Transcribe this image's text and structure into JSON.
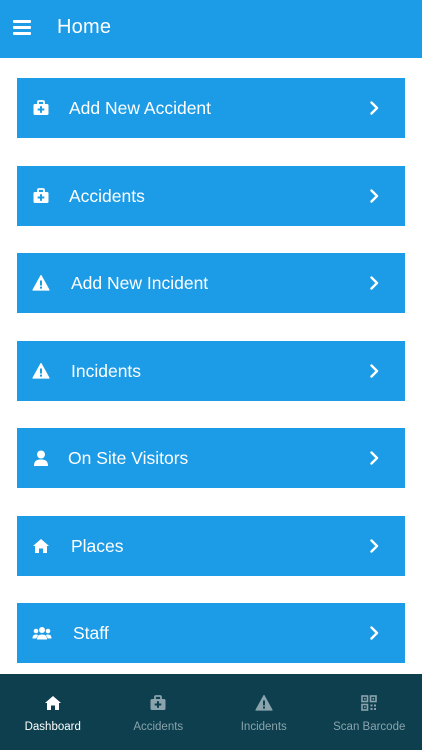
{
  "header": {
    "title": "Home",
    "menu_icon": "hamburger-icon"
  },
  "menu": {
    "items": [
      {
        "label": "Add New Accident",
        "icon": "first-aid-kit-icon"
      },
      {
        "label": "Accidents",
        "icon": "first-aid-kit-icon"
      },
      {
        "label": "Add New Incident",
        "icon": "warning-icon"
      },
      {
        "label": "Incidents",
        "icon": "warning-icon"
      },
      {
        "label": "On Site Visitors",
        "icon": "user-icon"
      },
      {
        "label": "Places",
        "icon": "home-icon"
      },
      {
        "label": "Staff",
        "icon": "users-icon"
      }
    ]
  },
  "bottom_nav": {
    "tabs": [
      {
        "label": "Dashboard",
        "icon": "home-icon",
        "active": true
      },
      {
        "label": "Accidents",
        "icon": "first-aid-kit-icon",
        "active": false
      },
      {
        "label": "Incidents",
        "icon": "warning-icon",
        "active": false
      },
      {
        "label": "Scan Barcode",
        "icon": "qr-code-icon",
        "active": false
      }
    ]
  },
  "colors": {
    "primary": "#1c9be6",
    "bottom_nav_bg": "#0d3f4e",
    "active_tab": "#ffffff",
    "inactive_tab": "#8aa3ac"
  }
}
